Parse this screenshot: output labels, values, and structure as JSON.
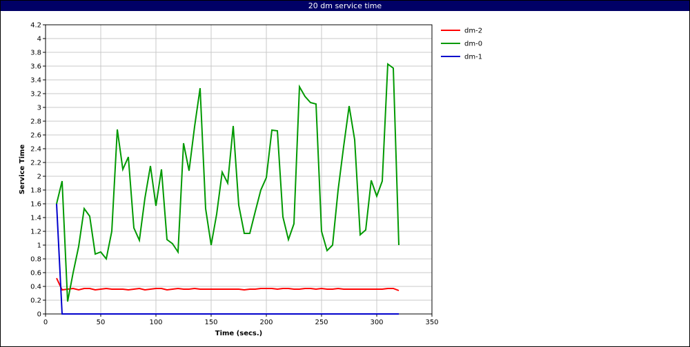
{
  "window": {
    "title": "20 dm service time"
  },
  "chart_data": {
    "type": "line",
    "title": "20 dm service time",
    "xlabel": "Time (secs.)",
    "ylabel": "Service Time",
    "xlim": [
      0,
      350
    ],
    "ylim": [
      0,
      4.2
    ],
    "xticks": [
      0,
      50,
      100,
      150,
      200,
      250,
      300,
      350
    ],
    "yticks": [
      0,
      0.2,
      0.4,
      0.6,
      0.8,
      1,
      1.2,
      1.4,
      1.6,
      1.8,
      2,
      2.2,
      2.4,
      2.6,
      2.8,
      3,
      3.2,
      3.4,
      3.6,
      3.8,
      4,
      4.2
    ],
    "grid": true,
    "legend_position": "right",
    "series": [
      {
        "name": "dm-2",
        "color": "#ff0000",
        "x": [
          10,
          15,
          20,
          25,
          30,
          35,
          40,
          45,
          50,
          55,
          60,
          65,
          70,
          75,
          80,
          85,
          90,
          95,
          100,
          105,
          110,
          115,
          120,
          125,
          130,
          135,
          140,
          145,
          150,
          155,
          160,
          165,
          170,
          175,
          180,
          185,
          190,
          195,
          200,
          205,
          210,
          215,
          220,
          225,
          230,
          235,
          240,
          245,
          250,
          255,
          260,
          265,
          270,
          275,
          280,
          285,
          290,
          295,
          300,
          305,
          310,
          315,
          320
        ],
        "y": [
          0.52,
          0.35,
          0.36,
          0.37,
          0.35,
          0.37,
          0.37,
          0.35,
          0.36,
          0.37,
          0.36,
          0.36,
          0.36,
          0.35,
          0.36,
          0.37,
          0.35,
          0.36,
          0.37,
          0.37,
          0.35,
          0.36,
          0.37,
          0.36,
          0.36,
          0.37,
          0.36,
          0.36,
          0.36,
          0.36,
          0.36,
          0.36,
          0.36,
          0.36,
          0.35,
          0.36,
          0.36,
          0.37,
          0.37,
          0.37,
          0.36,
          0.37,
          0.37,
          0.36,
          0.36,
          0.37,
          0.37,
          0.36,
          0.37,
          0.36,
          0.36,
          0.37,
          0.36,
          0.36,
          0.36,
          0.36,
          0.36,
          0.36,
          0.36,
          0.36,
          0.37,
          0.37,
          0.34
        ]
      },
      {
        "name": "dm-0",
        "color": "#009900",
        "x": [
          10,
          15,
          20,
          25,
          30,
          35,
          40,
          45,
          50,
          55,
          60,
          65,
          70,
          75,
          80,
          85,
          90,
          95,
          100,
          105,
          110,
          115,
          120,
          125,
          130,
          135,
          140,
          145,
          150,
          155,
          160,
          165,
          170,
          175,
          180,
          185,
          190,
          195,
          200,
          205,
          210,
          215,
          220,
          225,
          230,
          235,
          240,
          245,
          250,
          255,
          260,
          265,
          270,
          275,
          280,
          285,
          290,
          295,
          300,
          305,
          310,
          315,
          320
        ],
        "y": [
          1.6,
          1.93,
          0.18,
          0.6,
          0.98,
          1.53,
          1.42,
          0.87,
          0.9,
          0.8,
          1.2,
          2.68,
          2.1,
          2.28,
          1.25,
          1.07,
          1.68,
          2.15,
          1.57,
          2.1,
          1.08,
          1.02,
          0.9,
          2.48,
          2.08,
          2.72,
          3.28,
          1.53,
          1.0,
          1.45,
          2.06,
          1.9,
          2.73,
          1.58,
          1.17,
          1.17,
          1.49,
          1.8,
          1.98,
          2.67,
          2.66,
          1.41,
          1.08,
          1.31,
          3.3,
          3.16,
          3.07,
          3.05,
          1.2,
          0.92,
          1.0,
          1.8,
          2.43,
          3.02,
          2.53,
          1.15,
          1.22,
          1.94,
          1.71,
          1.93,
          3.63,
          3.57,
          1.0
        ]
      },
      {
        "name": "dm-1",
        "color": "#0000cc",
        "x": [
          10,
          15,
          20,
          320
        ],
        "y": [
          1.6,
          0.0,
          0.0,
          0.0
        ]
      }
    ]
  }
}
